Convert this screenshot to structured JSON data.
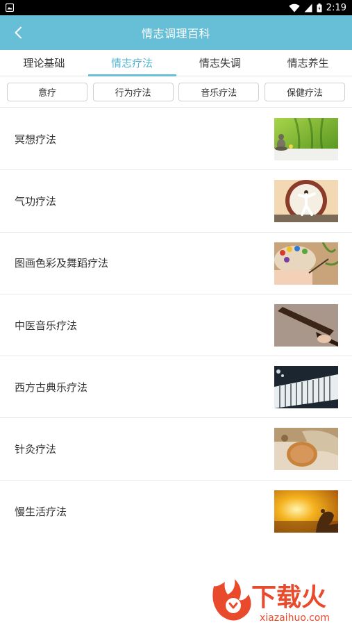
{
  "status": {
    "time": "2:19"
  },
  "header": {
    "title": "情志调理百科"
  },
  "tabs": [
    {
      "label": "理论基础"
    },
    {
      "label": "情志疗法"
    },
    {
      "label": "情志失调"
    },
    {
      "label": "情志养生"
    }
  ],
  "subtabs": [
    {
      "label": "意疗"
    },
    {
      "label": "行为疗法"
    },
    {
      "label": "音乐疗法"
    },
    {
      "label": "保健疗法"
    }
  ],
  "list": [
    {
      "label": "冥想疗法"
    },
    {
      "label": "气功疗法"
    },
    {
      "label": "图画色彩及舞蹈疗法"
    },
    {
      "label": "中医音乐疗法"
    },
    {
      "label": "西方古典乐疗法"
    },
    {
      "label": "针灸疗法"
    },
    {
      "label": "慢生活疗法"
    }
  ],
  "watermark": {
    "brand": "下载火",
    "domain": "xiazaihuo.com"
  },
  "colors": {
    "primary": "#67bfd7",
    "tab_active": "#55b5d0",
    "watermark": "#e8452c"
  }
}
